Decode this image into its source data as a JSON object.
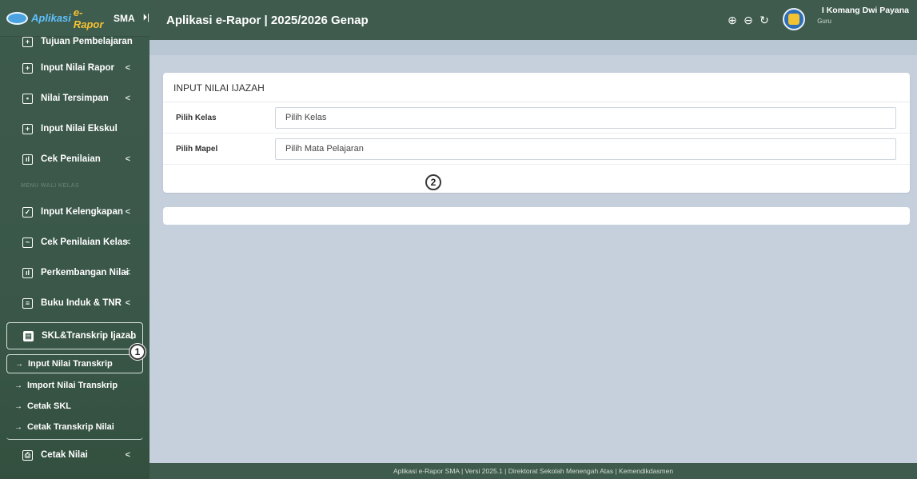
{
  "brand": {
    "part_a": "Aplikasi",
    "part_b": "e-Rapor",
    "part_c": "SMA",
    "toggle_icon": "collapse-icon"
  },
  "header": {
    "title": "Aplikasi e-Rapor | 2025/2026 Genap"
  },
  "user": {
    "name": "I Komang Dwi Payana",
    "role": "Guru"
  },
  "toolbar": {
    "zoom_in": "🔍+",
    "zoom_out": "🔍-",
    "reset": "↻"
  },
  "sidebar": {
    "items_top": [
      {
        "label": "Tujuan Pembelajaran",
        "icon": "add-box-icon"
      },
      {
        "label": "Input Nilai Rapor",
        "icon": "plus-box-icon",
        "chevron": "<"
      },
      {
        "label": "Nilai Tersimpan",
        "icon": "save-box-icon",
        "chevron": "<"
      },
      {
        "label": "Input Nilai Ekskul",
        "icon": "add-box-icon"
      },
      {
        "label": "Cek Penilaian",
        "icon": "chart-icon",
        "chevron": "<"
      }
    ],
    "section_header": "MENU WALI KELAS",
    "items_wali": [
      {
        "label": "Input Kelengkapan",
        "icon": "checkbox-icon",
        "chevron": "<"
      },
      {
        "label": "Cek Penilaian Kelas",
        "icon": "line-chart-icon",
        "chevron": "<"
      },
      {
        "label": "Perkembangan Nilai",
        "icon": "bar-chart-icon",
        "chevron": "<"
      },
      {
        "label": "Buku Induk & TNR",
        "icon": "book-icon",
        "chevron": "<"
      }
    ],
    "active_parent": {
      "label": "SKL&Transkrip Ijazah",
      "icon": "document-icon",
      "chevron": "⌄"
    },
    "subitems": [
      {
        "label": "Input Nilai Transkrip"
      },
      {
        "label": "Import Nilai Transkrip"
      },
      {
        "label": "Cetak SKL"
      },
      {
        "label": "Cetak Transkrip Nilai"
      }
    ],
    "print_item": {
      "label": "Cetak Nilai",
      "icon": "printer-icon",
      "chevron": "<"
    }
  },
  "annotations": {
    "badge1": "1",
    "badge2": "2"
  },
  "form": {
    "title": "INPUT NILAI IJAZAH",
    "kelas_label": "Pilih Kelas",
    "kelas_value": "Pilih Kelas",
    "mapel_label": "Pilih Mapel",
    "mapel_value": "Pilih Mata Pelajaran"
  },
  "footer": {
    "text": "Aplikasi e-Rapor SMA | Versi 2025.1 | Direktorat Sekolah Menengah Atas | Kemendikdasmen"
  }
}
